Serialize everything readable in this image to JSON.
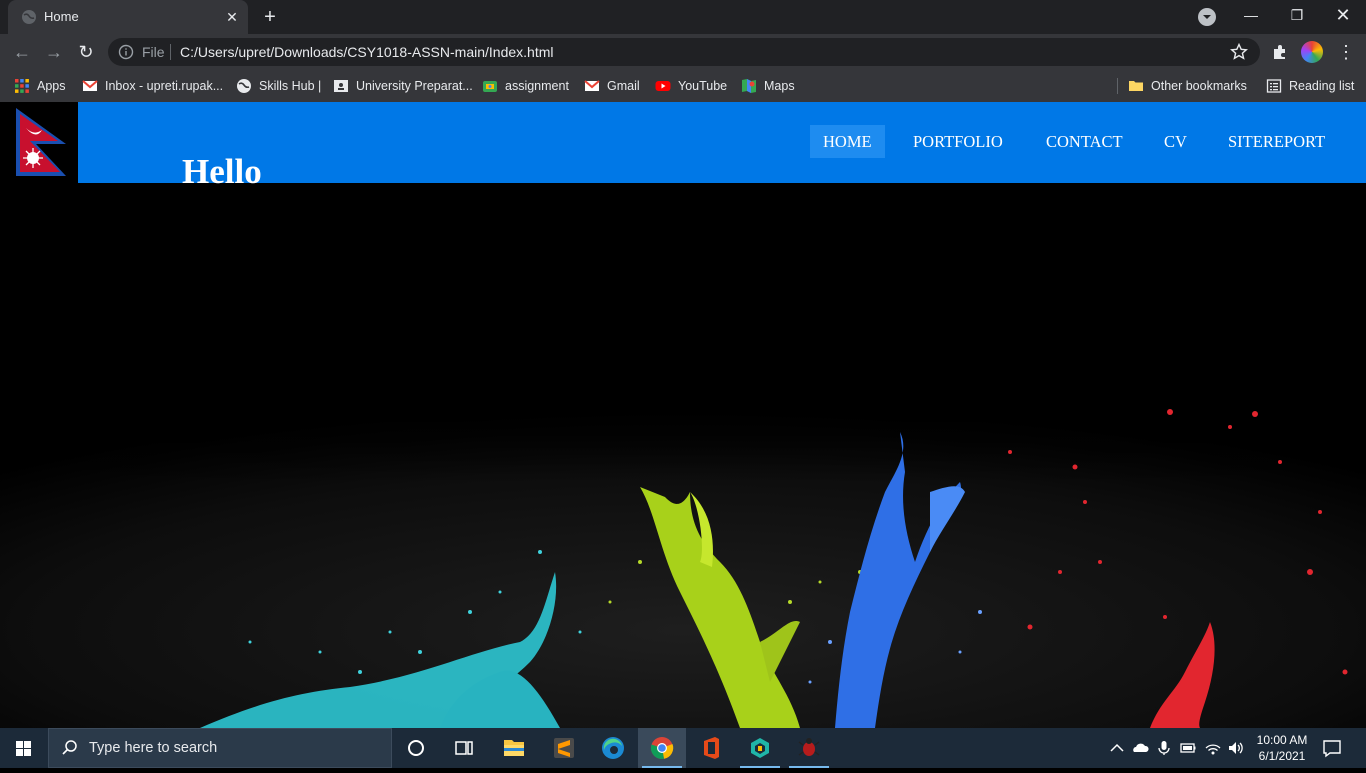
{
  "browser": {
    "tab": {
      "title": "Home",
      "favicon": "globe-icon"
    },
    "address": {
      "scheme_label": "File",
      "url": "C:/Users/upret/Downloads/CSY1018-ASSN-main/Index.html"
    },
    "bookmarks": [
      {
        "label": "Apps",
        "icon": "apps-grid-icon"
      },
      {
        "label": "Inbox - upreti.rupak...",
        "icon": "gmail-icon"
      },
      {
        "label": "Skills Hub |",
        "icon": "globe-icon"
      },
      {
        "label": "University Preparat...",
        "icon": "classroom-icon"
      },
      {
        "label": "assignment",
        "icon": "drive-icon"
      },
      {
        "label": "Gmail",
        "icon": "gmail-icon"
      },
      {
        "label": "YouTube",
        "icon": "youtube-icon"
      },
      {
        "label": "Maps",
        "icon": "maps-icon"
      }
    ],
    "other_bookmarks": "Other bookmarks",
    "reading_list": "Reading list"
  },
  "page": {
    "heading": "Hello",
    "nav": [
      {
        "label": "HOME",
        "active": true
      },
      {
        "label": "PORTFOLIO",
        "active": false
      },
      {
        "label": "CONTACT",
        "active": false
      },
      {
        "label": "CV",
        "active": false
      },
      {
        "label": "SITEREPORT",
        "active": false
      }
    ],
    "colors": {
      "header": "#0078e7",
      "active_nav": "#1e8cf0"
    }
  },
  "taskbar": {
    "search_placeholder": "Type here to search",
    "time": "10:00 AM",
    "date": "6/1/2021",
    "apps": [
      "cortana-icon",
      "task-view-icon",
      "file-explorer-icon",
      "sublime-text-icon",
      "edge-icon",
      "chrome-icon",
      "office-icon",
      "app-icon",
      "bug-icon"
    ]
  }
}
